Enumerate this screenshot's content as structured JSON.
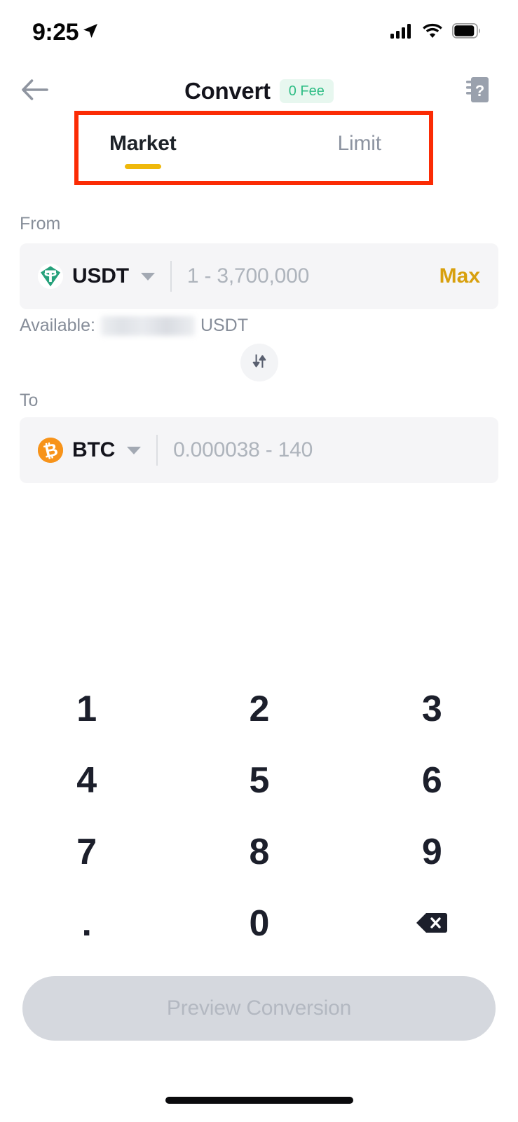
{
  "status_bar": {
    "time": "9:25",
    "location_icon": "location-arrow-icon",
    "signal_icon": "cellular-signal-icon",
    "wifi_icon": "wifi-icon",
    "battery_icon": "battery-icon"
  },
  "header": {
    "back_icon": "back-arrow-icon",
    "title": "Convert",
    "fee_badge": "0 Fee",
    "help_icon": "help-question-icon"
  },
  "tabs": {
    "items": [
      {
        "label": "Market",
        "active": true
      },
      {
        "label": "Limit",
        "active": false
      }
    ],
    "active_underline_color": "#efb80b",
    "highlight_color": "#fb2b04"
  },
  "from": {
    "label": "From",
    "coin": "USDT",
    "coin_icon": "tether-icon",
    "coin_icon_color": "#26a17b",
    "caret_icon": "chevron-down-icon",
    "amount_value": "",
    "amount_placeholder": "1 - 3,700,000",
    "max_label": "Max",
    "max_color": "#d8a00e",
    "available_label": "Available:",
    "available_value": "",
    "available_unit": "USDT"
  },
  "swap": {
    "icon": "swap-vertical-arrows-icon"
  },
  "to": {
    "label": "To",
    "coin": "BTC",
    "coin_icon": "bitcoin-icon",
    "coin_icon_color": "#f7931a",
    "caret_icon": "chevron-down-icon",
    "amount_value": "",
    "amount_placeholder": "0.000038 - 140"
  },
  "keypad": {
    "keys": [
      {
        "label": "1",
        "name": "key-1"
      },
      {
        "label": "2",
        "name": "key-2"
      },
      {
        "label": "3",
        "name": "key-3"
      },
      {
        "label": "4",
        "name": "key-4"
      },
      {
        "label": "5",
        "name": "key-5"
      },
      {
        "label": "6",
        "name": "key-6"
      },
      {
        "label": "7",
        "name": "key-7"
      },
      {
        "label": "8",
        "name": "key-8"
      },
      {
        "label": "9",
        "name": "key-9"
      },
      {
        "label": ".",
        "name": "key-decimal"
      },
      {
        "label": "0",
        "name": "key-0"
      },
      {
        "label": "",
        "name": "key-backspace",
        "icon": "backspace-icon"
      }
    ]
  },
  "footer": {
    "preview_label": "Preview Conversion",
    "preview_disabled": true
  }
}
